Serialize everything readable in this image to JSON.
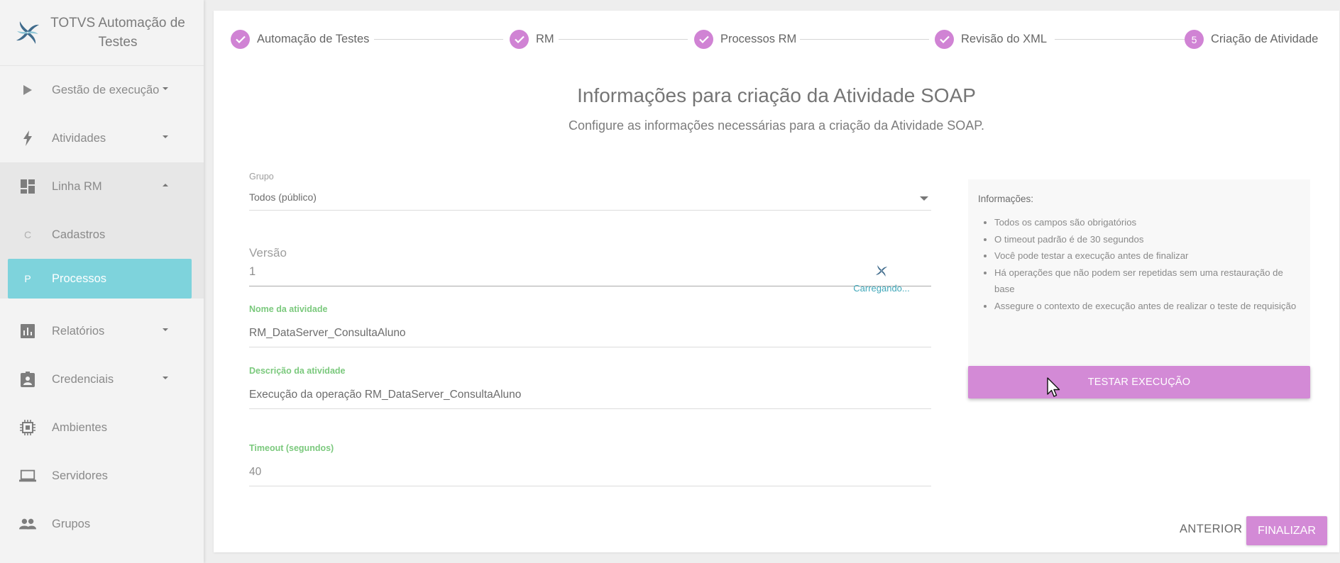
{
  "app": {
    "title": "TOTVS Automação de Testes"
  },
  "sidebar": {
    "items": [
      {
        "label": "Gestão de execução",
        "icon": "play-icon"
      },
      {
        "label": "Atividades",
        "icon": "bolt-icon"
      },
      {
        "label": "Linha RM",
        "icon": "dashboard-icon"
      },
      {
        "label": "Relatórios",
        "icon": "chart-icon"
      },
      {
        "label": "Credenciais",
        "icon": "badge-icon"
      },
      {
        "label": "Ambientes",
        "icon": "chip-icon"
      },
      {
        "label": "Servidores",
        "icon": "laptop-icon"
      },
      {
        "label": "Grupos",
        "icon": "people-icon"
      }
    ],
    "subitems": [
      {
        "letter": "C",
        "label": "Cadastros"
      },
      {
        "letter": "P",
        "label": "Processos"
      }
    ]
  },
  "stepper": {
    "steps": [
      {
        "label": "Automação de Testes",
        "state": "done"
      },
      {
        "label": "RM",
        "state": "done"
      },
      {
        "label": "Processos RM",
        "state": "done"
      },
      {
        "label": "Revisão do XML",
        "state": "done"
      },
      {
        "label": "Criação de Atividade",
        "state": "current",
        "number": "5"
      }
    ]
  },
  "page": {
    "title": "Informações para criação da Atividade SOAP",
    "subtitle": "Configure as informações necessárias para a criação da Atividade SOAP."
  },
  "form": {
    "grupo": {
      "label": "Grupo",
      "value": "Todos (público)"
    },
    "versao": {
      "label": "Versão",
      "value": "1"
    },
    "nome": {
      "label": "Nome da atividade",
      "value": "RM_DataServer_ConsultaAluno"
    },
    "descricao": {
      "label": "Descrição da atividade",
      "value": "Execução da operação RM_DataServer_ConsultaAluno"
    },
    "timeout": {
      "label": "Timeout (segundos)",
      "value": "40"
    }
  },
  "loader": {
    "text": "Carregando..."
  },
  "info": {
    "title": "Informações:",
    "items": [
      "Todos os campos são obrigatórios",
      "O timeout padrão é de 30 segundos",
      "Você pode testar a execução antes de finalizar",
      "Há operações que não podem ser repetidas sem uma restauração de base",
      "Assegure o contexto de execução antes de realizar o teste de requisição"
    ]
  },
  "actions": {
    "test": "TESTAR EXECUÇÃO",
    "previous": "ANTERIOR",
    "finish": "FINALIZAR"
  },
  "colors": {
    "accent": "#d38ad6",
    "active_nav": "#7ed3dc",
    "label_green": "#7bc97d"
  }
}
